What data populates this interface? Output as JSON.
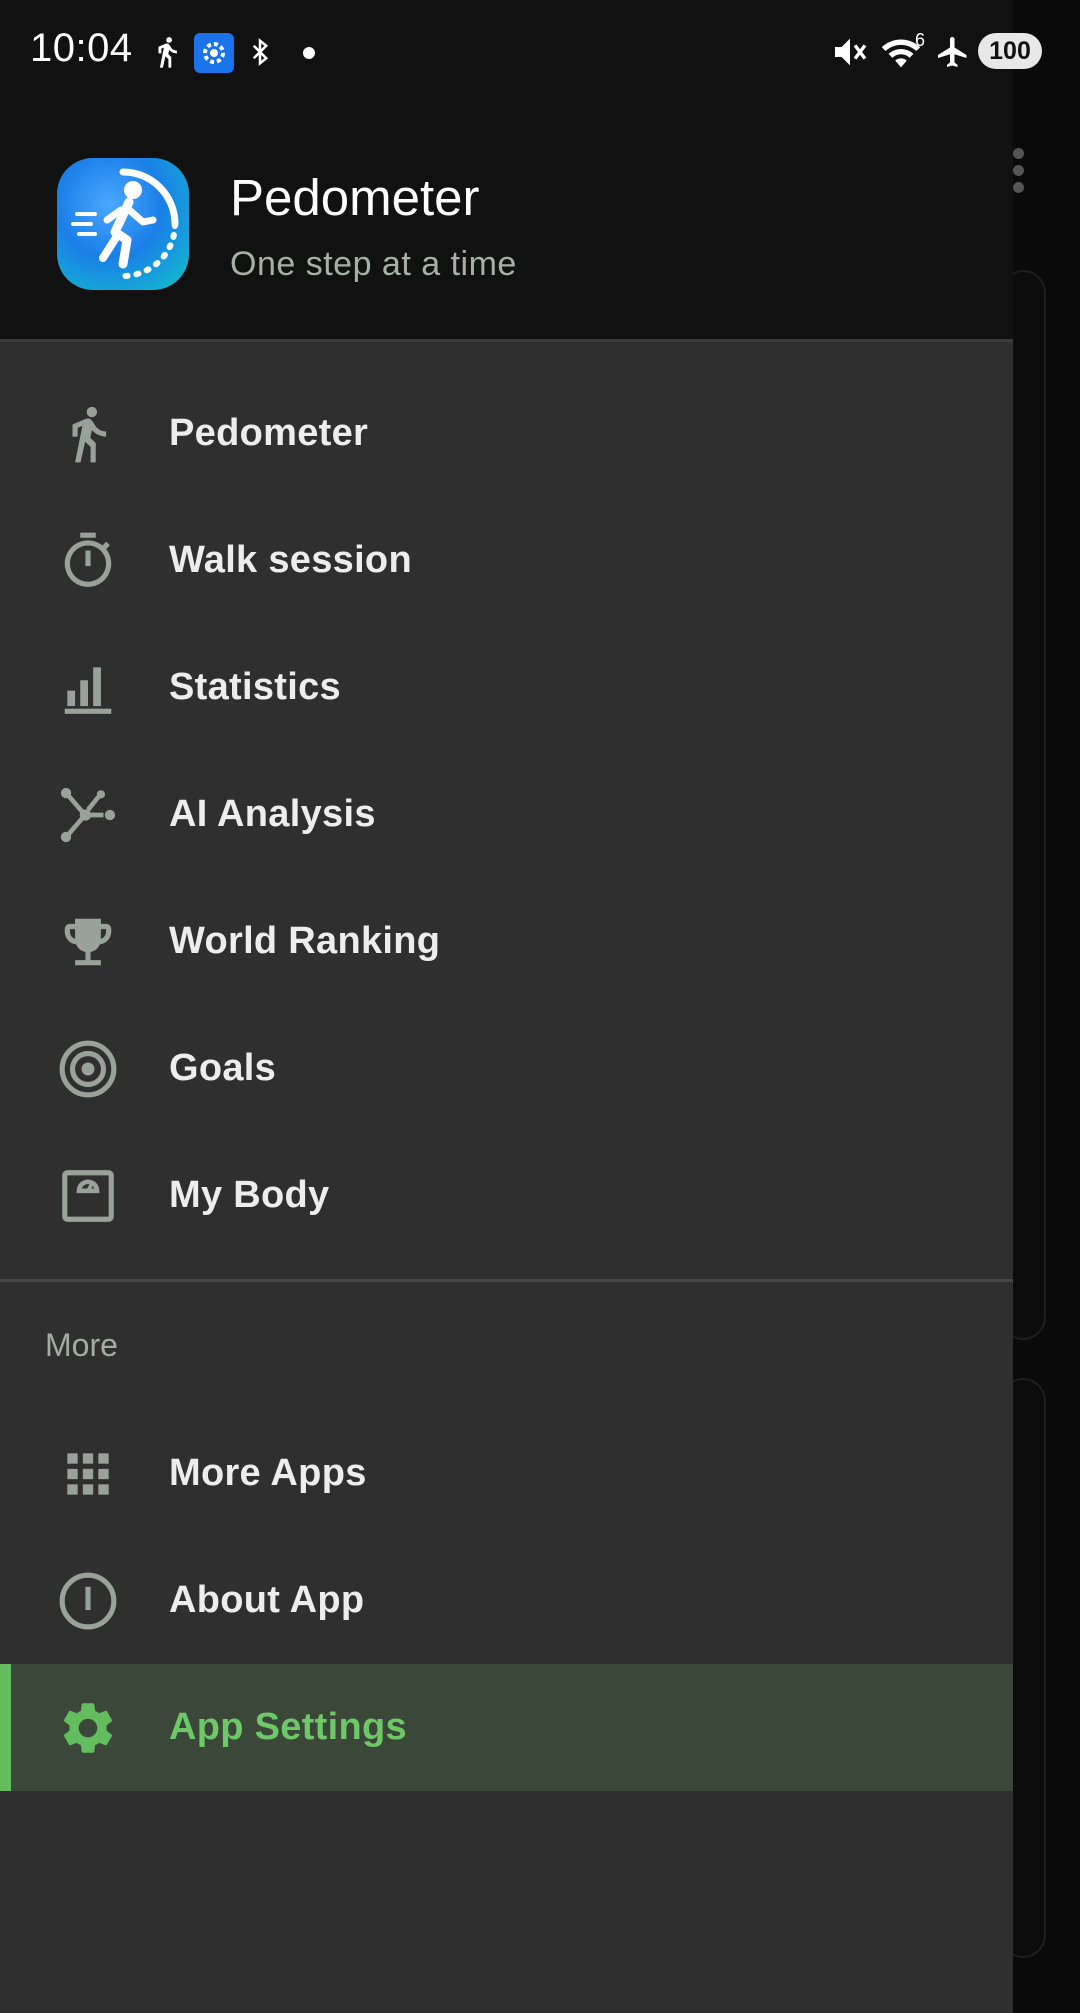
{
  "status_bar": {
    "time": "10:04",
    "left_icons": [
      "walk-icon",
      "settings-app-icon",
      "bluetooth-icon",
      "dot-icon"
    ],
    "right_icons": [
      "mute-icon",
      "wifi-icon",
      "airplane-icon"
    ],
    "wifi_badge": "6",
    "battery": "100"
  },
  "drawer": {
    "header": {
      "title": "Pedometer",
      "subtitle": "One step at a time"
    },
    "items": [
      {
        "label": "Pedometer",
        "icon": "walk-icon"
      },
      {
        "label": "Walk session",
        "icon": "stopwatch-icon"
      },
      {
        "label": "Statistics",
        "icon": "bar-chart-icon"
      },
      {
        "label": "AI Analysis",
        "icon": "ai-network-icon"
      },
      {
        "label": "World Ranking",
        "icon": "trophy-icon"
      },
      {
        "label": "Goals",
        "icon": "target-icon"
      },
      {
        "label": "My Body",
        "icon": "scale-icon"
      }
    ],
    "more_section": {
      "label": "More",
      "items": [
        {
          "label": "More Apps",
          "icon": "grid-icon"
        },
        {
          "label": "About App",
          "icon": "info-icon"
        },
        {
          "label": "App Settings",
          "icon": "gear-icon",
          "selected": true
        }
      ]
    }
  },
  "colors": {
    "accent": "#63bd5e",
    "drawer_bg": "#2f2f2f",
    "header_bg": "#111111",
    "icon_gray": "#9aa19a",
    "selected_bg": "#3a4739"
  }
}
